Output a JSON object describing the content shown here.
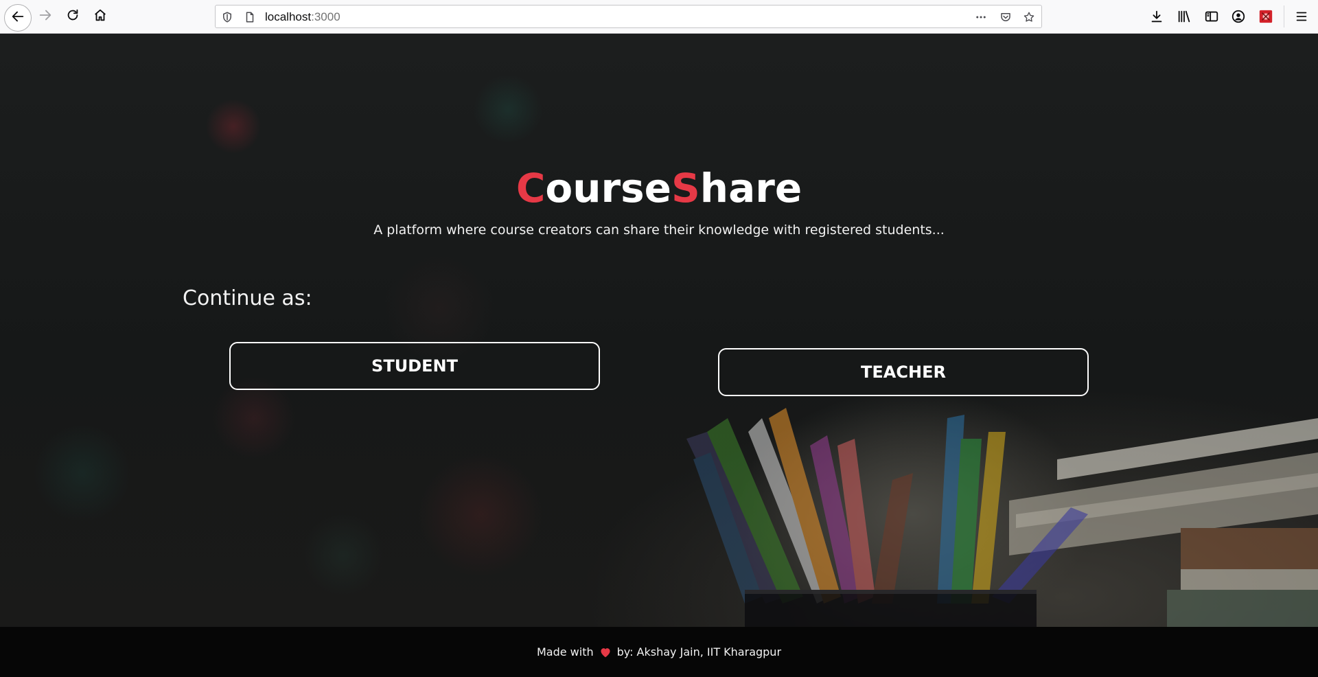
{
  "browser": {
    "url_host": "localhost",
    "url_port": ":3000",
    "icons": {
      "back": "arrow-left-icon",
      "forward": "arrow-right-icon",
      "reload": "reload-icon",
      "home": "home-icon",
      "tracking": "shield-icon",
      "page_info": "page-icon",
      "more": "more-icon",
      "pocket": "pocket-icon",
      "bookmark": "star-icon",
      "downloads": "download-icon",
      "library": "library-icon",
      "sidebar": "sidebar-icon",
      "account": "account-icon",
      "extension": "extension-icon",
      "menu": "hamburger-menu-icon"
    }
  },
  "hero": {
    "title_part1_accent": "C",
    "title_part1_rest": "ourse",
    "title_part2_accent": "S",
    "title_part2_rest": "hare",
    "subtitle": "A platform where course creators can share their knowledge with registered students...",
    "accent_color": "#e63946"
  },
  "roles": {
    "prompt": "Continue as:",
    "student_label": "STUDENT",
    "teacher_label": "TEACHER"
  },
  "footer": {
    "made_with": "Made with",
    "by_text": "by: Akshay Jain, IIT Kharagpur",
    "heart_icon": "heart-icon",
    "heart_color": "#e63946"
  }
}
